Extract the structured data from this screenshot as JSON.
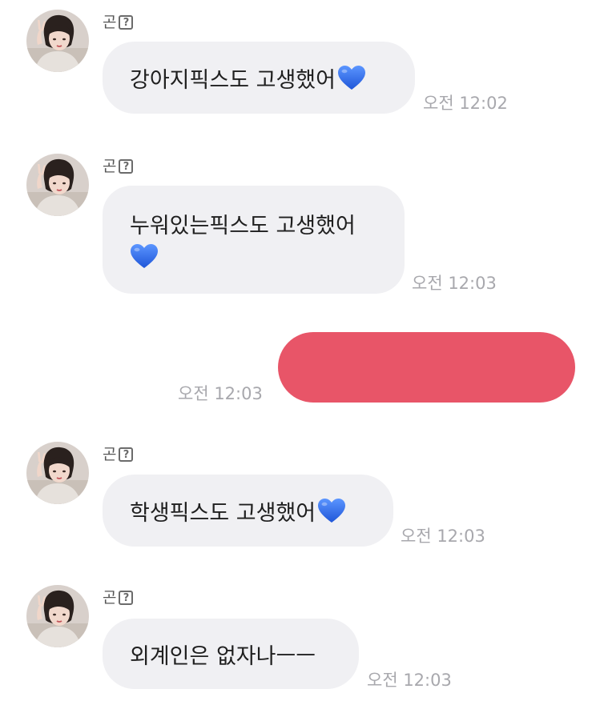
{
  "messages": [
    {
      "sender": "곤",
      "text": "강아지픽스도 고생했어",
      "emoji": "blue-heart",
      "time": "오전 12:02"
    },
    {
      "sender": "곤",
      "text": "누워있는픽스도 고생했어",
      "emoji": "blue-heart",
      "time": "오전 12:03"
    },
    {
      "outgoing": true,
      "time": "오전 12:03"
    },
    {
      "sender": "곤",
      "text": "학생픽스도 고생했어",
      "emoji": "blue-heart",
      "time": "오전 12:03"
    },
    {
      "sender": "곤",
      "text": "외계인은 없자나ㅡㅡ",
      "time": "오전 12:03"
    }
  ],
  "colors": {
    "incoming_bubble": "#f0f0f3",
    "outgoing_bubble": "#e85568",
    "timestamp": "#a8a8ad",
    "heart": "#2f6be8"
  }
}
